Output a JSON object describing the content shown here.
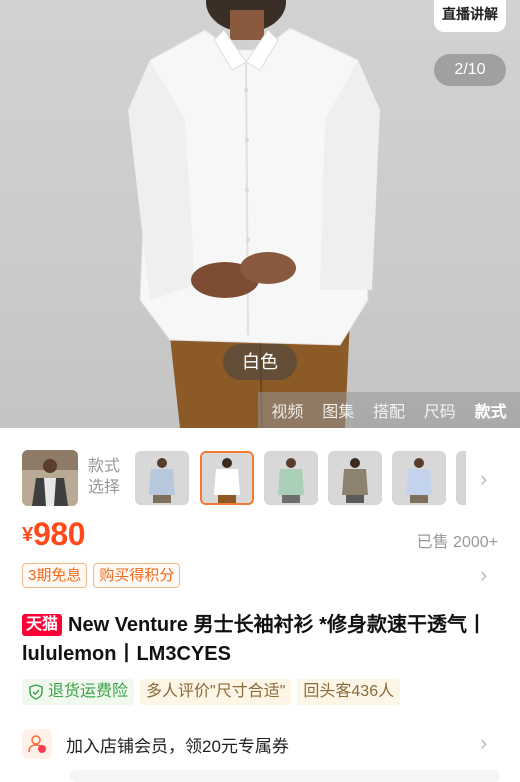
{
  "hero": {
    "live_button": "直播讲解",
    "image_counter": "2/10",
    "color_tag": "白色",
    "media_tabs": [
      {
        "label": "视频",
        "active": false
      },
      {
        "label": "图集",
        "active": false
      },
      {
        "label": "搭配",
        "active": false
      },
      {
        "label": "尺码",
        "active": false
      },
      {
        "label": "款式",
        "active": true
      }
    ]
  },
  "variants": {
    "label": "款式\n选择",
    "shirt_colors": [
      "#b7c7dc",
      "#ffffff",
      "#a9d0b6",
      "#8d8170",
      "#c4d3ec"
    ]
  },
  "price": {
    "currency": "¥",
    "amount": "980",
    "sold": "已售 2000+"
  },
  "promo_tags": [
    "3期免息",
    "购买得积分"
  ],
  "product": {
    "badge": "天猫",
    "title": "New Venture 男士长袖衬衫 *修身款速干透气丨lululemon丨LM3CYES"
  },
  "features": [
    {
      "label": "退货运费险",
      "icon": "shield-check-icon"
    },
    {
      "label": "多人评价\"尺寸合适\""
    },
    {
      "label": "回头客436人"
    }
  ],
  "member": {
    "text": "加入店铺会员，领20元专属券"
  },
  "colors": {
    "accent": "#ff4a1c",
    "tmall_red": "#ff0036",
    "selected_border": "#f07a2e"
  }
}
